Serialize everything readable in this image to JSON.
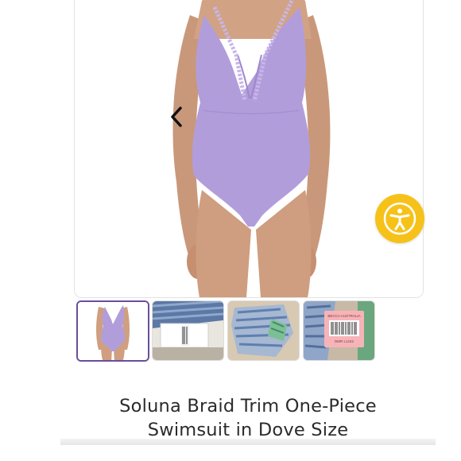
{
  "product": {
    "title_line1": "Soluna Braid Trim One-Piece",
    "title_line2": "Swimsuit in Dove Size"
  },
  "gallery": {
    "swimsuit_color": "#b29ddb",
    "skin_color": "#cf9f80",
    "prev_icon": "chevron-left-icon",
    "next_icon": "chevron-right-icon",
    "thumbnails": [
      {
        "label": "swimsuit-front",
        "selected": true
      },
      {
        "label": "tag-close-up",
        "selected": false
      },
      {
        "label": "packaging-print",
        "selected": false
      },
      {
        "label": "barcode-tag",
        "selected": false
      }
    ]
  },
  "barcode_tag": {
    "brand": "BECCA AUSTRALIA",
    "code": "DMR L1242"
  },
  "accessibility": {
    "icon": "accessibility-icon",
    "color": "#f6c21a"
  }
}
